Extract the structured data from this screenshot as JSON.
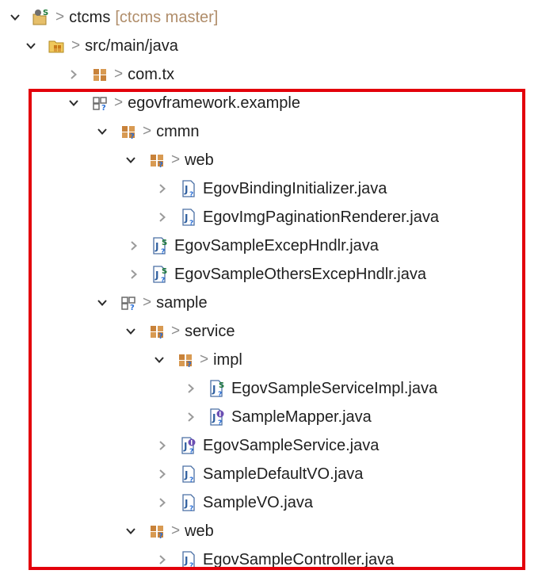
{
  "tree": {
    "rows": [
      {
        "label": "ctcms",
        "decoration": "[ctcms master]",
        "icon": "project-icon",
        "expanded": true,
        "gt": true
      },
      {
        "label": "src/main/java",
        "icon": "source-folder-icon",
        "expanded": true,
        "gt": true
      },
      {
        "label": "com.tx",
        "icon": "package-icon",
        "expanded": false,
        "gt": true
      },
      {
        "label": "egovframework.example",
        "icon": "empty-package-icon",
        "expanded": true,
        "gt": true
      },
      {
        "label": "cmmn",
        "icon": "package-icon",
        "expanded": true,
        "gt": true
      },
      {
        "label": "web",
        "icon": "package-icon",
        "expanded": true,
        "gt": true
      },
      {
        "label": "EgovBindingInitializer.java",
        "icon": "java-file-icon",
        "expanded": false,
        "gt": false
      },
      {
        "label": "EgovImgPaginationRenderer.java",
        "icon": "java-file-icon",
        "expanded": false,
        "gt": false
      },
      {
        "label": "EgovSampleExcepHndlr.java",
        "icon": "java-service-file-icon",
        "expanded": false,
        "gt": false
      },
      {
        "label": "EgovSampleOthersExcepHndlr.java",
        "icon": "java-service-file-icon",
        "expanded": false,
        "gt": false
      },
      {
        "label": "sample",
        "icon": "empty-package-icon",
        "expanded": true,
        "gt": true
      },
      {
        "label": "service",
        "icon": "package-icon",
        "expanded": true,
        "gt": true
      },
      {
        "label": "impl",
        "icon": "package-icon",
        "expanded": true,
        "gt": true
      },
      {
        "label": "EgovSampleServiceImpl.java",
        "icon": "java-service-file-icon",
        "expanded": false,
        "gt": false
      },
      {
        "label": "SampleMapper.java",
        "icon": "java-interface-file-icon",
        "expanded": false,
        "gt": false
      },
      {
        "label": "EgovSampleService.java",
        "icon": "java-interface-file-icon",
        "expanded": false,
        "gt": false
      },
      {
        "label": "SampleDefaultVO.java",
        "icon": "java-file-icon",
        "expanded": false,
        "gt": false
      },
      {
        "label": "SampleVO.java",
        "icon": "java-file-icon",
        "expanded": false,
        "gt": false
      },
      {
        "label": "web",
        "icon": "package-icon",
        "expanded": true,
        "gt": true
      },
      {
        "label": "EgovSampleController.java",
        "icon": "java-file-icon",
        "expanded": false,
        "gt": false
      }
    ]
  },
  "colors": {
    "highlight_border": "#e3000b",
    "decoration_text": "#b08d6a",
    "gt_marker": "#8c8c8c"
  },
  "markers": {
    "gt": ">"
  }
}
